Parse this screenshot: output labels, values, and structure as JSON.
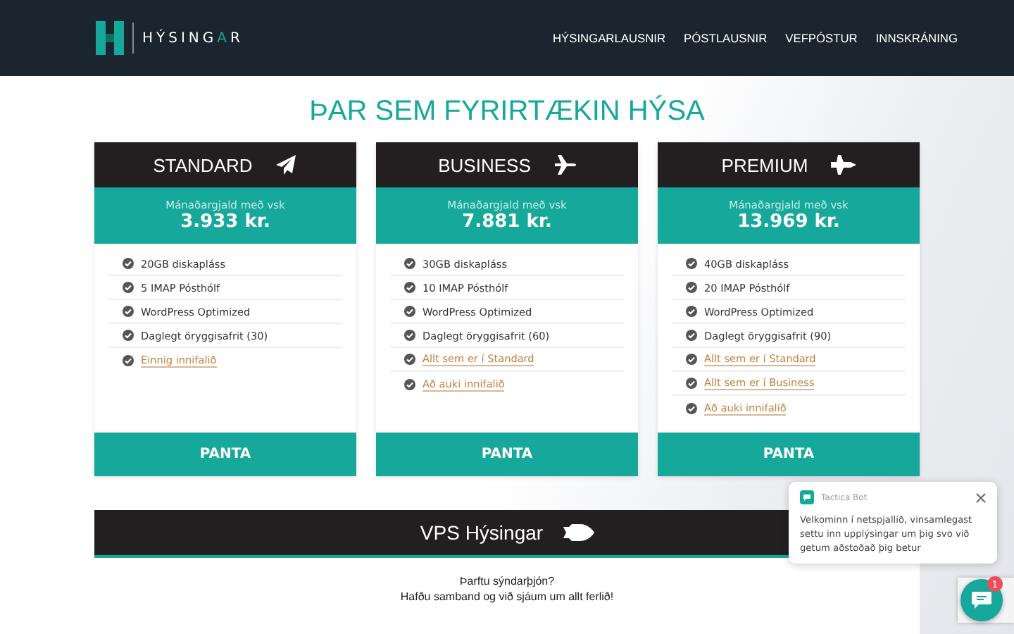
{
  "logo": {
    "before": "HÝSING",
    "accent": "A",
    "after": "R"
  },
  "nav": [
    "HÝSINGARLAUSNIR",
    "PÓSTLAUSNIR",
    "VEFPÓSTUR",
    "INNSKRÁNING"
  ],
  "headline": "ÞAR SEM FYRIRTÆKIN HÝSA",
  "plans": [
    {
      "name": "STANDARD",
      "price_label": "Mánaðargjald með vsk",
      "price": "3.933 kr.",
      "features": [
        {
          "kind": "text",
          "text": "20GB diskapláss"
        },
        {
          "kind": "text",
          "text": "5 IMAP Pósthólf"
        },
        {
          "kind": "text",
          "text": "WordPress Optimized"
        },
        {
          "kind": "text",
          "text": "Daglegt öryggisafrit (30)"
        },
        {
          "kind": "link",
          "text": "Einnig innifalið"
        }
      ],
      "button": "PANTA"
    },
    {
      "name": "BUSINESS",
      "price_label": "Mánaðargjald með vsk",
      "price": "7.881 kr.",
      "features": [
        {
          "kind": "text",
          "text": "30GB diskapláss"
        },
        {
          "kind": "text",
          "text": "10 IMAP Pósthólf"
        },
        {
          "kind": "text",
          "text": "WordPress Optimized"
        },
        {
          "kind": "text",
          "text": "Daglegt öryggisafrit (60)"
        },
        {
          "kind": "link",
          "text": "Allt sem er í Standard"
        },
        {
          "kind": "link",
          "text": "Að auki innifalið"
        }
      ],
      "button": "PANTA"
    },
    {
      "name": "PREMIUM",
      "price_label": "Mánaðargjald með vsk",
      "price": "13.969 kr.",
      "features": [
        {
          "kind": "text",
          "text": "40GB diskapláss"
        },
        {
          "kind": "text",
          "text": "20 IMAP Pósthólf"
        },
        {
          "kind": "text",
          "text": "WordPress Optimized"
        },
        {
          "kind": "text",
          "text": "Daglegt öryggisafrit (90)"
        },
        {
          "kind": "link",
          "text": "Allt sem er í Standard"
        },
        {
          "kind": "link",
          "text": "Allt sem er í Business"
        },
        {
          "kind": "link",
          "text": "Að auki innifalið"
        }
      ],
      "button": "PANTA"
    }
  ],
  "vps": {
    "title": "VPS Hýsingar",
    "lines": [
      "Þarftu sýndarþjón?",
      "Hafðu samband og við sjáum um allt ferlið!"
    ]
  },
  "chat": {
    "bot_name": "Tactica Bot",
    "message": "Velkominn í netspjallið, vinsamlegast settu inn upplýsingar um þig svo við getum aðstoðað þig betur",
    "badge": "1"
  }
}
